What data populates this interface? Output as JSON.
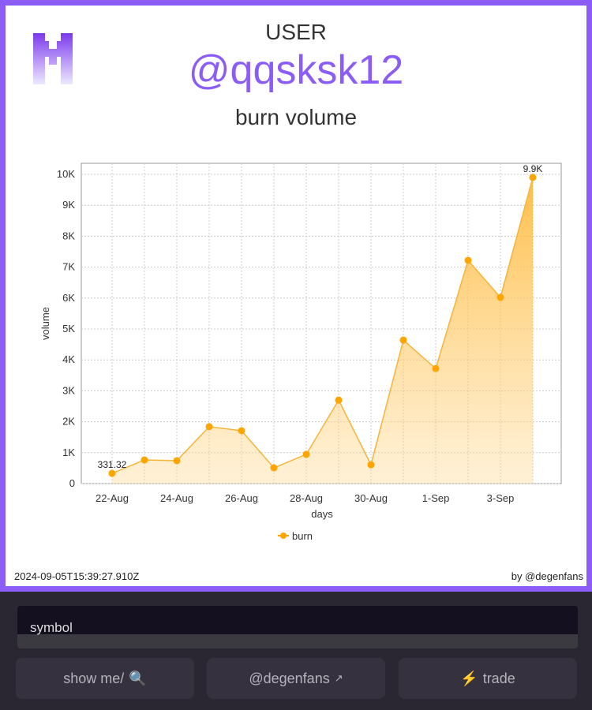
{
  "header": {
    "label": "USER",
    "handle": "@qqsksk12",
    "title": "burn volume"
  },
  "footer": {
    "timestamp": "2024-09-05T15:39:27.910Z",
    "credit": "by @degenfans"
  },
  "controls": {
    "symbol_value": "symbol",
    "buttons": [
      {
        "label": "show me/",
        "icon": "magnifier-icon"
      },
      {
        "label": "@degenfans",
        "icon": "external-link-icon"
      },
      {
        "label": "trade",
        "icon": "lightning-icon"
      }
    ]
  },
  "colors": {
    "accent": "#8b5cf6",
    "series": "#ffa500"
  },
  "chart_data": {
    "type": "area",
    "xlabel": "days",
    "ylabel": "volume",
    "x": [
      "22-Aug",
      "23-Aug",
      "24-Aug",
      "25-Aug",
      "26-Aug",
      "27-Aug",
      "28-Aug",
      "29-Aug",
      "30-Aug",
      "31-Aug",
      "1-Sep",
      "2-Sep",
      "3-Sep",
      "4-Sep"
    ],
    "xticks": [
      "22-Aug",
      "24-Aug",
      "26-Aug",
      "28-Aug",
      "30-Aug",
      "1-Sep",
      "3-Sep"
    ],
    "yticks": [
      "0",
      "1K",
      "2K",
      "3K",
      "4K",
      "5K",
      "6K",
      "7K",
      "8K",
      "9K",
      "10K"
    ],
    "ylim": [
      0,
      10000
    ],
    "grid": true,
    "legend": "bottom",
    "series": [
      {
        "name": "burn",
        "values": [
          331.32,
          765,
          740,
          1840,
          1710,
          510,
          945,
          2700,
          610,
          4640,
          3720,
          7220,
          6020,
          9900
        ]
      }
    ],
    "annotations": [
      {
        "index": 0,
        "text": "331.32"
      },
      {
        "index": 13,
        "text": "9.9K"
      }
    ]
  }
}
